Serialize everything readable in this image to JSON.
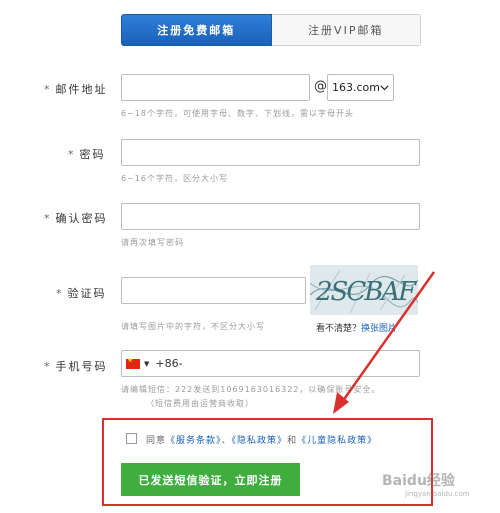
{
  "tabs": [
    {
      "label": "注册免费邮箱",
      "active": true
    },
    {
      "label": "注册VIP邮箱",
      "active": false
    }
  ],
  "email": {
    "label": "邮件地址",
    "required_mark": "*",
    "value": "",
    "at": "@",
    "domain": "163.com",
    "hint": "6~18个字符，可使用字母、数字、下划线，需以字母开头"
  },
  "password": {
    "label": "密码",
    "required_mark": "*",
    "value": "",
    "hint": "6~16个字符，区分大小写"
  },
  "confirm": {
    "label": "确认密码",
    "required_mark": "*",
    "value": "",
    "hint": "请再次填写密码"
  },
  "captcha": {
    "label": "验证码",
    "required_mark": "*",
    "value": "",
    "image_text": "2SCBAF",
    "hint": "请填写图片中的字符，不区分大小写",
    "unclear": "看不清楚？",
    "refresh": "换张图片"
  },
  "phone": {
    "label": "手机号码",
    "required_mark": "*",
    "country_code": "+86-",
    "value": "",
    "hint1": "请编辑短信：222发送到1069163016322，以确保账号安全。",
    "hint2": "（短信费用由运营商收取）"
  },
  "agreement": {
    "prefix": "同意",
    "terms": "《服务条款》",
    "sep1": "、",
    "privacy": "《隐私政策》",
    "and": "和",
    "child_privacy": "《儿童隐私政策》"
  },
  "submit_label": "已发送短信验证，立即注册",
  "watermark": "Baidu经验",
  "watermark_url": "jingyan.baidu.com",
  "colors": {
    "primary": "#1b62b9",
    "submit": "#3fae3f",
    "highlight": "#d93030"
  }
}
